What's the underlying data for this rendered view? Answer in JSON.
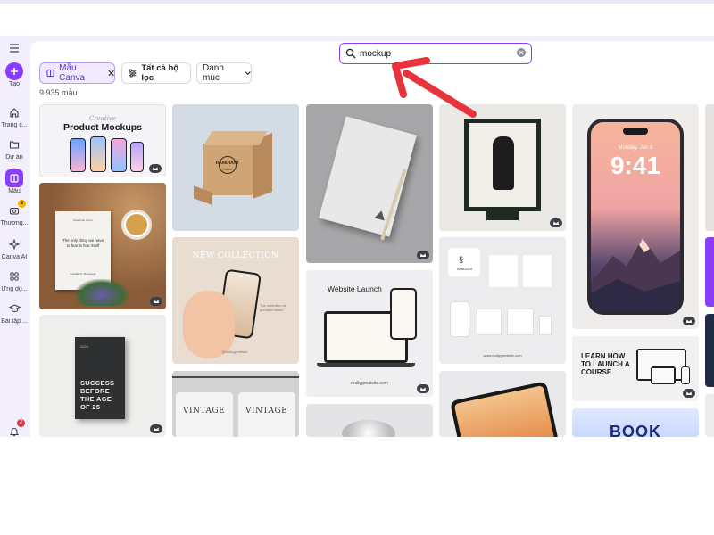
{
  "sidebar": {
    "items": [
      {
        "label": "Tạo",
        "icon": "plus-icon"
      },
      {
        "label": "Trang c...",
        "icon": "home-icon"
      },
      {
        "label": "Dự án",
        "icon": "folder-icon"
      },
      {
        "label": "Mẫu",
        "icon": "templates-icon"
      },
      {
        "label": "Thương...",
        "icon": "brand-icon"
      },
      {
        "label": "Canva AI",
        "icon": "sparkle-icon"
      },
      {
        "label": "Ứng dụ...",
        "icon": "apps-icon"
      },
      {
        "label": "Bài tập ...",
        "icon": "graduation-cap-icon"
      }
    ],
    "notifications_count": "2"
  },
  "search": {
    "value": "mockup"
  },
  "filters": {
    "canva_templates": "Mẫu Canva",
    "all_filters": "Tất cả bộ lọc",
    "category": "Danh mục"
  },
  "result_count": "9.935 mẫu",
  "templates": {
    "product_mockups": {
      "script": "Creative",
      "title": "Product Mockups"
    },
    "box": {
      "brand": "RAMDIANT",
      "sub": "Coffee"
    },
    "book": {
      "header": "Notebook Cover",
      "quote": "The only thing we have to fear is fear itself",
      "footer": "Franklin D. Roosevelt"
    },
    "collection": {
      "title": "NEW COLLECTION",
      "sub": "The collection of premium items",
      "handle": "@reallygreatsite"
    },
    "website": {
      "title": "Website Launch",
      "url": "reallygreatsite.com"
    },
    "stationery": {
      "brand": "SANDCER",
      "url": "www.reallygreatsite.com"
    },
    "phone": {
      "date": "Monday, Jan 8",
      "time": "9:41"
    },
    "success": {
      "small": "2024",
      "title": "SUCCESS BEFORE THE AGE OF 25"
    },
    "shirts": {
      "left": "VINTAGE",
      "right": "VINTAGE"
    },
    "course": {
      "title": "LEARN HOW TO LAUNCH A COURSE"
    },
    "bookpromo": {
      "title": "BOOK"
    }
  },
  "colors": {
    "accent": "#8b3dff",
    "annotation_arrow": "#e8323c"
  }
}
